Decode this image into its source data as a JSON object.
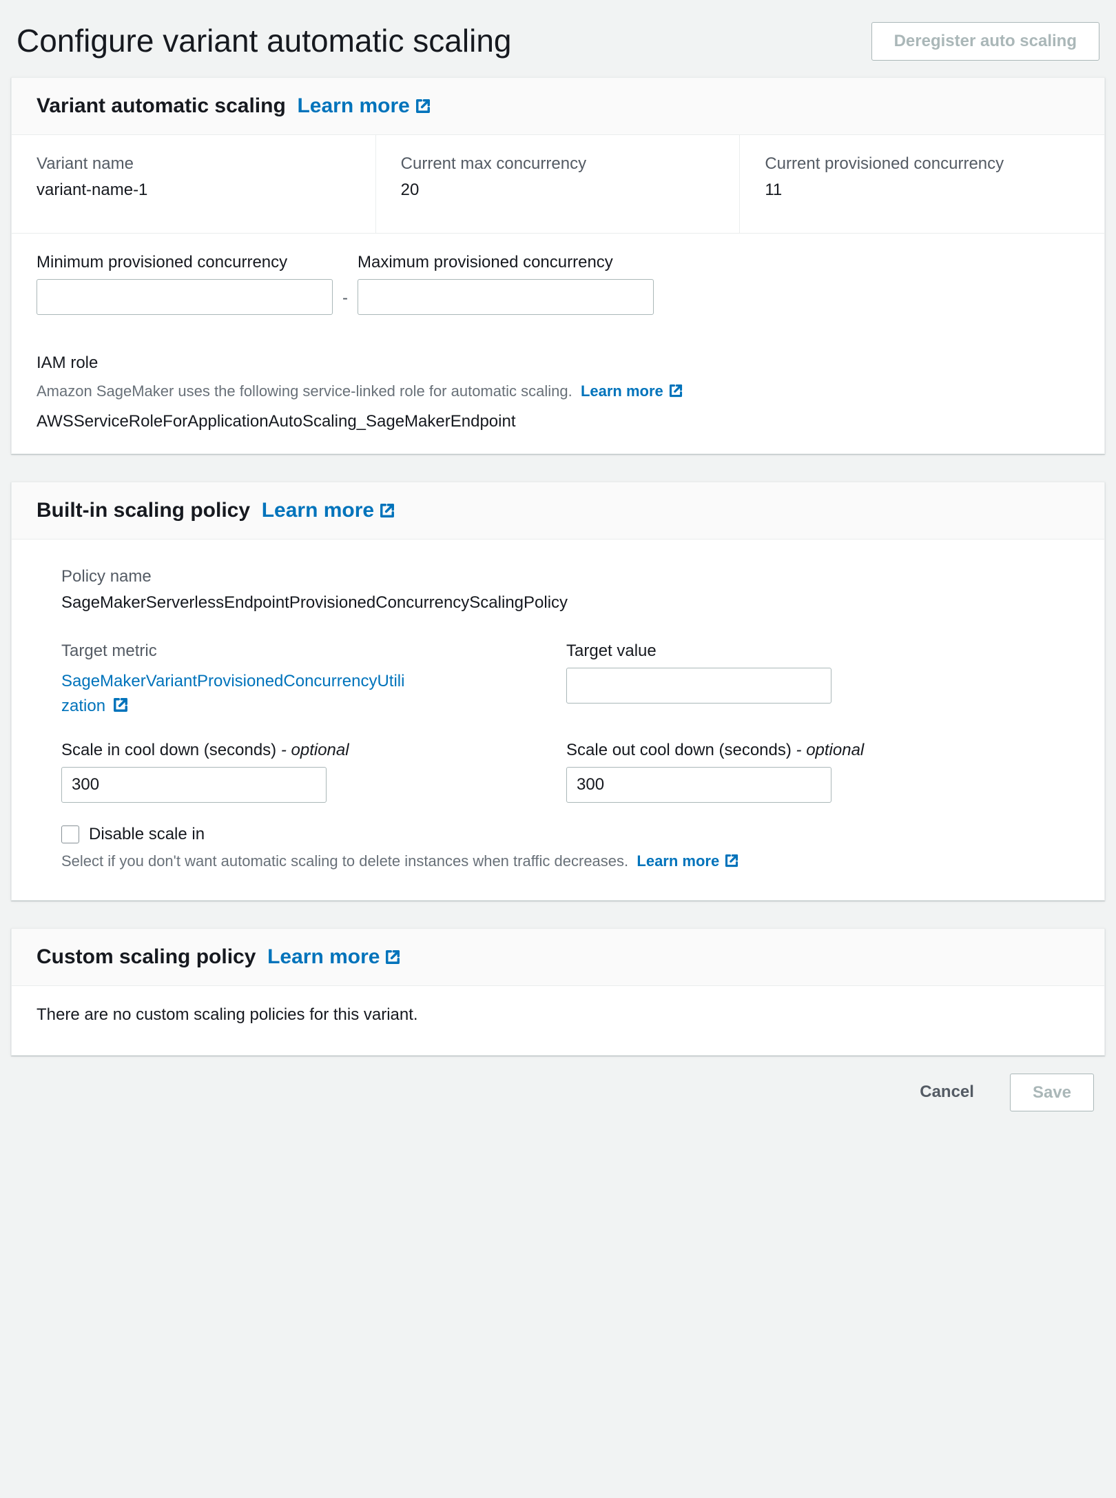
{
  "page": {
    "title": "Configure variant automatic scaling",
    "deregister_label": "Deregister auto scaling"
  },
  "section1": {
    "title": "Variant automatic scaling",
    "learn_more": "Learn more",
    "variant_name_label": "Variant name",
    "variant_name_value": "variant-name-1",
    "current_max_concurrency_label": "Current max concurrency",
    "current_max_concurrency_value": "20",
    "current_provisioned_concurrency_label": "Current provisioned concurrency",
    "current_provisioned_concurrency_value": "11",
    "min_pc_label": "Minimum provisioned concurrency",
    "max_pc_label": "Maximum provisioned concurrency",
    "min_pc_value": "",
    "max_pc_value": "",
    "iam_role_label": "IAM role",
    "iam_role_hint": "Amazon SageMaker uses the following service-linked role for automatic scaling.",
    "iam_role_hint_link": "Learn more",
    "iam_role_value": "AWSServiceRoleForApplicationAutoScaling_SageMakerEndpoint"
  },
  "section2": {
    "title": "Built-in scaling policy",
    "learn_more": "Learn more",
    "policy_name_label": "Policy name",
    "policy_name_value": "SageMakerServerlessEndpointProvisionedConcurrencyScalingPolicy",
    "target_metric_label": "Target metric",
    "target_metric_value": "SageMakerVariantProvisionedConcurrencyUtilization",
    "target_value_label": "Target value",
    "target_value_value": "",
    "scale_in_label": "Scale in cool down (seconds)",
    "scale_out_label": "Scale out cool down (seconds)",
    "optional_label": "- optional",
    "scale_in_value": "300",
    "scale_out_value": "300",
    "disable_scale_in_label": "Disable scale in",
    "disable_scale_in_hint": "Select if you don't want automatic scaling to delete instances when traffic decreases.",
    "disable_scale_in_hint_link": "Learn more"
  },
  "section3": {
    "title": "Custom scaling policy",
    "learn_more": "Learn more",
    "empty_text": "There are no custom scaling policies for this variant."
  },
  "footer": {
    "cancel": "Cancel",
    "save": "Save"
  }
}
